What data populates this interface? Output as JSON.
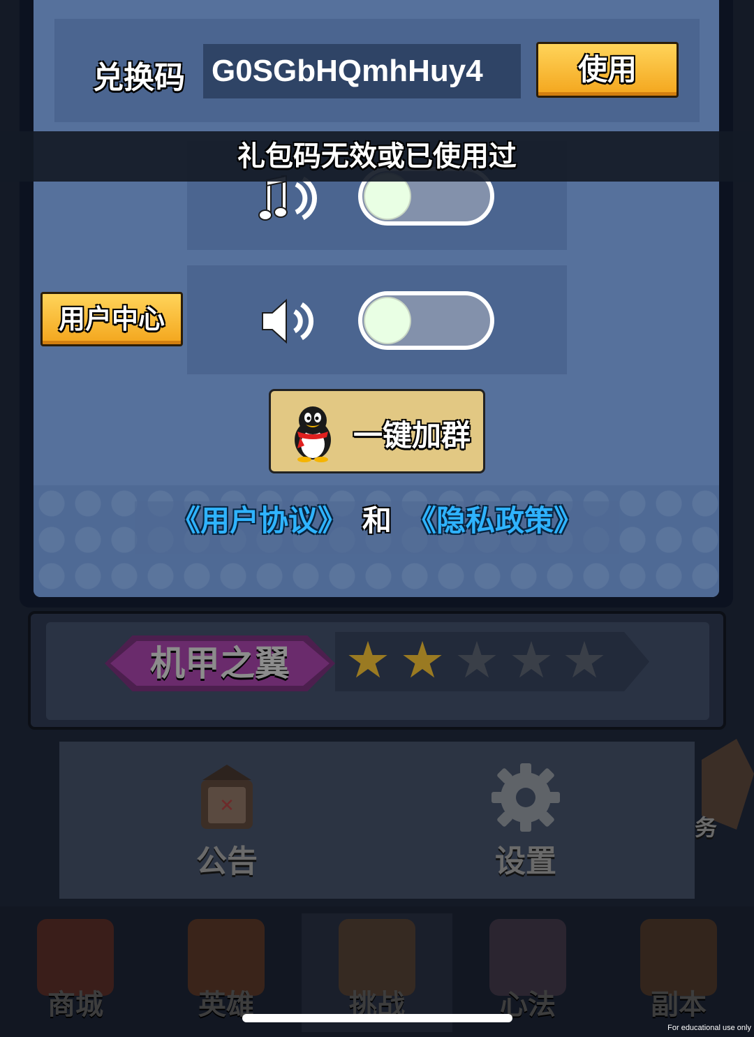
{
  "redeem": {
    "label": "兑换码",
    "code_value": "G0SGbHQmhHuy4",
    "use_button": "使用"
  },
  "toast": {
    "message": "礼包码无效或已使用过"
  },
  "settings": {
    "music_toggle": {
      "icon": "music-note-icon",
      "enabled": false
    },
    "sound_toggle": {
      "icon": "speaker-icon",
      "enabled": false
    },
    "user_center_button": "用户中心",
    "join_group_button": "一键加群",
    "join_group_icon": "qq-penguin-icon",
    "user_agreement_link": "《用户协议》",
    "and_text": "和",
    "privacy_policy_link": "《隐私政策》"
  },
  "background": {
    "rank": {
      "name": "机甲之翼",
      "stars_filled": 2,
      "stars_total": 5
    },
    "menu": [
      {
        "label": "公告",
        "icon": "announcement-icon"
      },
      {
        "label": "设置",
        "icon": "gear-icon"
      }
    ],
    "side_task_label": "务",
    "bottom_nav": [
      {
        "label": "商城",
        "icon": "shop-icon"
      },
      {
        "label": "英雄",
        "icon": "hero-icon"
      },
      {
        "label": "挑战",
        "icon": "challenge-icon"
      },
      {
        "label": "心法",
        "icon": "scroll-icon"
      },
      {
        "label": "副本",
        "icon": "dungeon-icon"
      }
    ]
  },
  "colors": {
    "modal_bg": "#56719c",
    "row_bg": "#4b6590",
    "button_orange": "#f3a51c",
    "link_blue": "#2fb3ff",
    "toggle_off": "#8391ab"
  },
  "watermark": "For educational use only"
}
